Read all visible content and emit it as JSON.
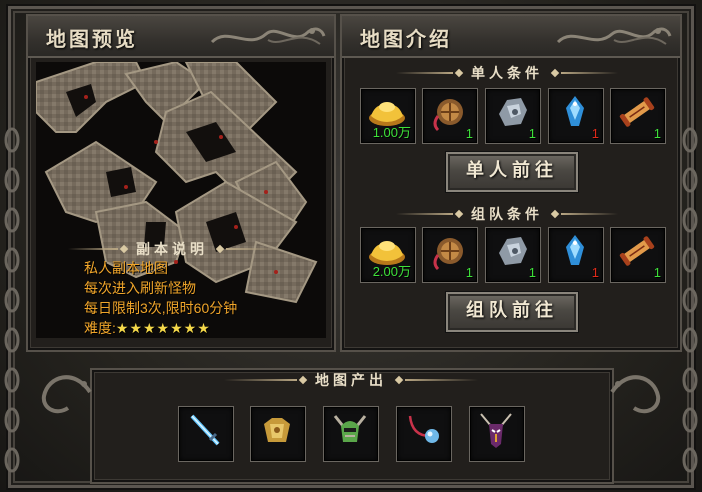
{
  "preview": {
    "title": "地图预览",
    "desc_title": "副本说明",
    "lines": [
      "私人副本地图",
      "每次进入刷新怪物",
      "每日限制3次,限时60分钟"
    ],
    "difficulty_label": "难度:",
    "difficulty_stars": "★★★★★★★"
  },
  "intro": {
    "title": "地图介绍",
    "solo_header": "单人条件",
    "solo_items": [
      {
        "icon": "gold-ingot-icon",
        "count": "1.00万",
        "color": "#3ee03a"
      },
      {
        "icon": "gourd-pouch-icon",
        "count": "1",
        "color": "#3ee03a"
      },
      {
        "icon": "silver-ore-icon",
        "count": "1",
        "color": "#3ee03a"
      },
      {
        "icon": "blue-crystal-icon",
        "count": "1",
        "color": "#e02a1a"
      },
      {
        "icon": "scroll-icon",
        "count": "1",
        "color": "#3ee03a"
      }
    ],
    "solo_button": "单人前往",
    "team_header": "组队条件",
    "team_items": [
      {
        "icon": "gold-ingot-icon",
        "count": "2.00万",
        "color": "#3ee03a"
      },
      {
        "icon": "gourd-pouch-icon",
        "count": "1",
        "color": "#3ee03a"
      },
      {
        "icon": "silver-ore-icon",
        "count": "1",
        "color": "#3ee03a"
      },
      {
        "icon": "blue-crystal-icon",
        "count": "1",
        "color": "#e02a1a"
      },
      {
        "icon": "scroll-icon",
        "count": "1",
        "color": "#3ee03a"
      }
    ],
    "team_button": "组队前往"
  },
  "drops": {
    "header": "地图产出",
    "items": [
      "blue-sword-icon",
      "golden-armor-icon",
      "horned-helmet-icon",
      "necklace-icon",
      "demon-mask-icon"
    ]
  },
  "colors": {
    "gold_text": "#f0a52a",
    "count_green": "#3ee03a",
    "count_red": "#e02a1a"
  }
}
